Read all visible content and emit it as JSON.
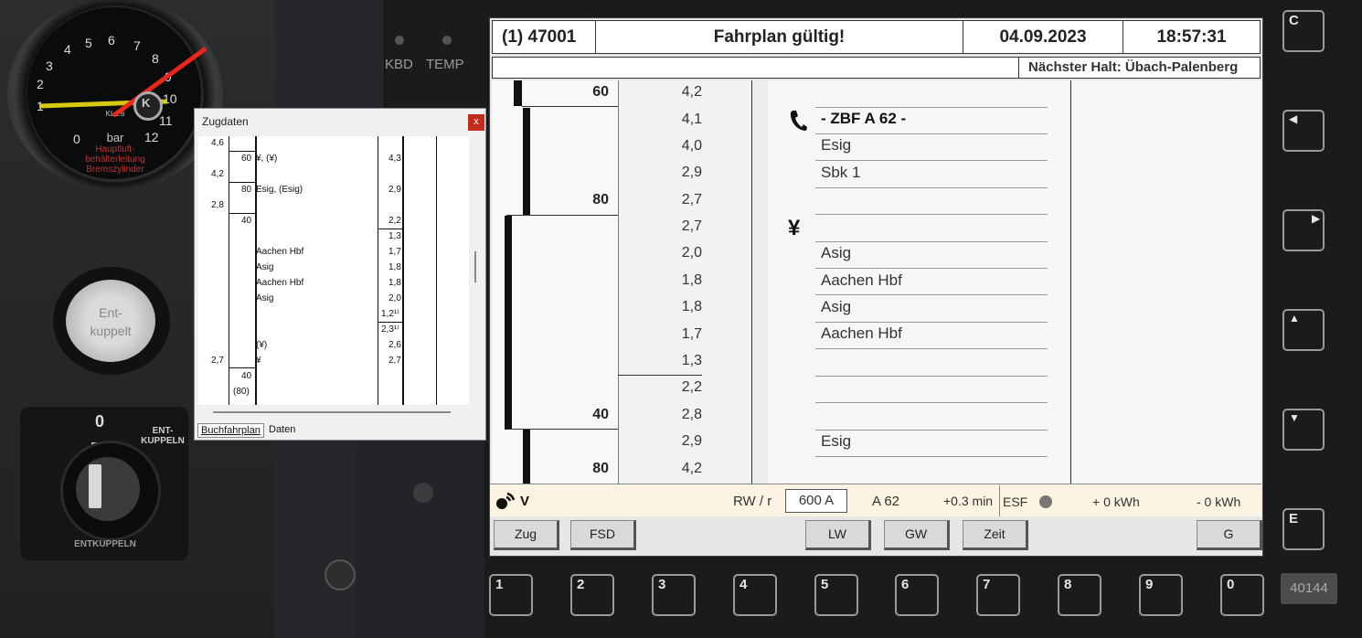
{
  "cab": {
    "gauge": {
      "numbers": [
        "1",
        "2",
        "3",
        "4",
        "5",
        "6",
        "7",
        "8",
        "9",
        "10",
        "11",
        "12",
        "0"
      ],
      "unit": "bar",
      "small": "KL1.6",
      "label_red_1": "Hauptluft-",
      "label_red_2": "behälterleitung",
      "label_red_3": "Bremszylinder",
      "logo": "K"
    },
    "kbd_label": "KBD",
    "temp_label": "TEMP",
    "button_line1": "Ent-",
    "button_line2": "kuppelt",
    "key_zero": "0",
    "key_top_label_1": "ENT-",
    "key_top_label_2": "KUPPELN",
    "key_bottom_label": "ENTKUPPELN"
  },
  "zugdaten": {
    "title": "Zugdaten",
    "close": "x",
    "tabs": [
      "Buchfahrplan",
      "Daten"
    ],
    "rows": [
      {
        "a": "4,6",
        "b": "",
        "c": "",
        "d": ""
      },
      {
        "a": "",
        "b": "60",
        "c": "¥, (¥)",
        "d": "4,3"
      },
      {
        "a": "4,2",
        "b": "",
        "c": "",
        "d": ""
      },
      {
        "a": "",
        "b": "80",
        "c": "Esig, (Esig)",
        "d": "2,9"
      },
      {
        "a": "2,8",
        "b": "",
        "c": "",
        "d": ""
      },
      {
        "a": "",
        "b": "40",
        "c": "",
        "d": "2,2"
      },
      {
        "a": "",
        "b": "",
        "c": "",
        "d": "1,3"
      },
      {
        "a": "",
        "b": "",
        "c": "Aachen Hbf",
        "d": "1,7"
      },
      {
        "a": "",
        "b": "",
        "c": "Asig",
        "d": "1,8"
      },
      {
        "a": "",
        "b": "",
        "c": "Aachen Hbf",
        "d": "1,8"
      },
      {
        "a": "",
        "b": "",
        "c": "Asig",
        "d": "2,0"
      },
      {
        "a": "",
        "b": "",
        "c": "",
        "d": "1,2¹⁾"
      },
      {
        "a": "",
        "b": "",
        "c": "",
        "d": "2,3¹⁾"
      },
      {
        "a": "",
        "b": "",
        "c": "(¥)",
        "d": "2,6"
      },
      {
        "a": "2,7",
        "b": "",
        "c": "¥",
        "d": "2,7"
      },
      {
        "a": "",
        "b": "40",
        "c": "",
        "d": ""
      },
      {
        "a": "",
        "b": "(80)",
        "c": "",
        "d": ""
      }
    ]
  },
  "ebula": {
    "train": "(1) 47001",
    "status": "Fahrplan gültig!",
    "date": "04.09.2023",
    "time": "18:57:31",
    "next_stop": "Nächster Halt: Übach-Palenberg",
    "speeds": [
      {
        "label": "60"
      },
      {
        "label": "80"
      },
      {
        "label": "40"
      },
      {
        "label": "80"
      }
    ],
    "km": [
      "4,2",
      "4,1",
      "4,0",
      "2,9",
      "2,7",
      "2,7",
      "2,0",
      "1,8",
      "1,8",
      "1,7",
      "1,3",
      "2,2",
      "2,8",
      "2,9",
      "4,2"
    ],
    "entries": [
      "- ZBF A 62 -",
      "Esig",
      "Sbk 1",
      "",
      "",
      "Asig",
      "Aachen Hbf",
      "Asig",
      "Aachen Hbf",
      "",
      "",
      "",
      "Esig",
      ""
    ],
    "yen_symbol": "¥",
    "status_bar": {
      "mode": "V",
      "rw": "RW / r",
      "current": "600 A",
      "line": "A 62",
      "delay": "+0.3 min",
      "esf": "ESF",
      "kwh_plus": "+ 0 kWh",
      "kwh_minus": "- 0 kWh"
    },
    "softkeys": {
      "zug": "Zug",
      "fsd": "FSD",
      "lw": "LW",
      "gw": "GW",
      "zeit": "Zeit",
      "g": "G"
    }
  },
  "hardkeys": {
    "right": [
      "C",
      "◀",
      "▶",
      "▲",
      "▼",
      "E"
    ],
    "bottom": [
      "1",
      "2",
      "3",
      "4",
      "5",
      "6",
      "7",
      "8",
      "9",
      "0"
    ],
    "badge": "40144"
  },
  "colors": {
    "accent_red": "#e8261a",
    "needle_yellow": "#d6c90f",
    "status_bg": "#fbf4e2"
  }
}
